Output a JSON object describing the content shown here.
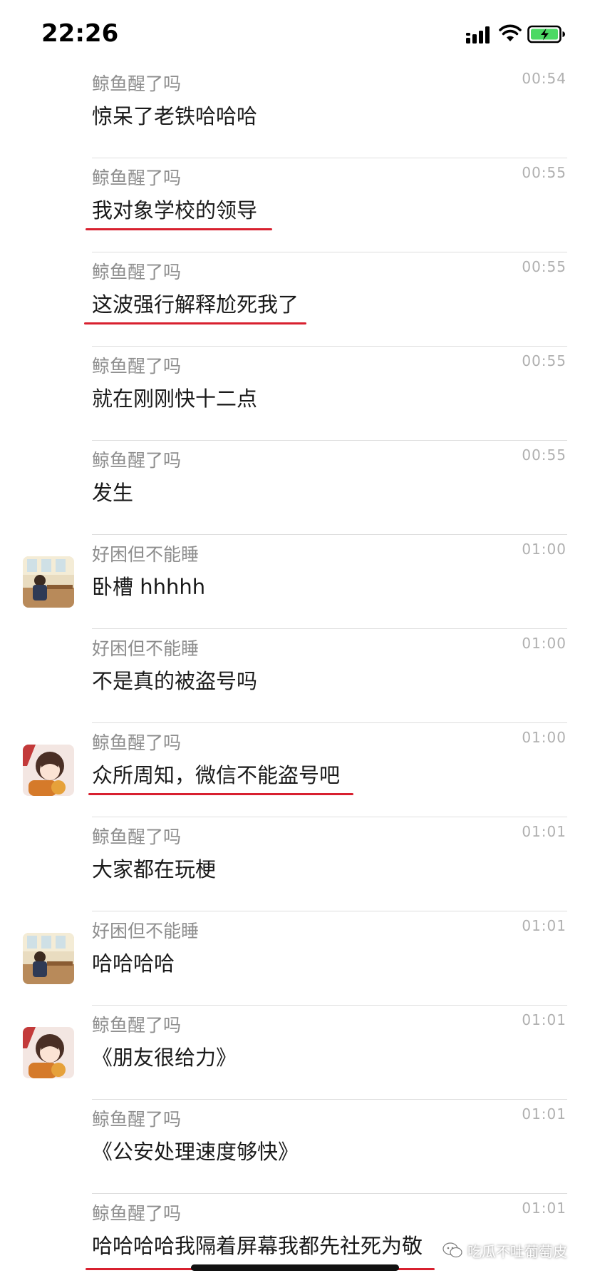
{
  "status_bar": {
    "time": "22:26",
    "signal_icon": "cellular-signal-icon",
    "wifi_icon": "wifi-icon",
    "battery_icon": "battery-charging-icon",
    "battery_color": "#4cd964"
  },
  "messages": [
    {
      "sender": "鲸鱼醒了吗",
      "time": "00:54",
      "text": "惊呆了老铁哈哈哈",
      "highlighted": false
    },
    {
      "sender": "鲸鱼醒了吗",
      "time": "00:55",
      "text": "我对象学校的领导",
      "highlighted": true
    },
    {
      "sender": "鲸鱼醒了吗",
      "time": "00:55",
      "text": "这波强行解释尬死我了",
      "highlighted": true
    },
    {
      "sender": "鲸鱼醒了吗",
      "time": "00:55",
      "text": "就在刚刚快十二点",
      "highlighted": false
    },
    {
      "sender": "鲸鱼醒了吗",
      "time": "00:55",
      "text": "发生",
      "highlighted": false
    },
    {
      "sender": "好困但不能睡",
      "time": "01:00",
      "text": "卧槽 hhhhh",
      "highlighted": false,
      "avatar": "avatar-classroom"
    },
    {
      "sender": "好困但不能睡",
      "time": "01:00",
      "text": "不是真的被盗号吗",
      "highlighted": false
    },
    {
      "sender": "鲸鱼醒了吗",
      "time": "01:00",
      "text": "众所周知，微信不能盗号吧",
      "highlighted": true,
      "avatar": "avatar-anime-girl"
    },
    {
      "sender": "鲸鱼醒了吗",
      "time": "01:01",
      "text": "大家都在玩梗",
      "highlighted": false
    },
    {
      "sender": "好困但不能睡",
      "time": "01:01",
      "text": "哈哈哈哈",
      "highlighted": false,
      "avatar": "avatar-classroom"
    },
    {
      "sender": "鲸鱼醒了吗",
      "time": "01:01",
      "text": "《朋友很给力》",
      "highlighted": false,
      "avatar": "avatar-anime-girl"
    },
    {
      "sender": "鲸鱼醒了吗",
      "time": "01:01",
      "text": "《公安处理速度够快》",
      "highlighted": false
    },
    {
      "sender": "鲸鱼醒了吗",
      "time": "01:01",
      "text": "哈哈哈哈我隔着屏幕我都先社死为敬",
      "highlighted": true
    }
  ],
  "watermark": {
    "icon": "wechat-official-account-icon",
    "text": "吃瓜不吐葡萄皮"
  },
  "colors": {
    "underline": "#d8202f",
    "sender": "#8e8e8e",
    "time": "#b0b0b0",
    "text": "#1a1a1a"
  }
}
